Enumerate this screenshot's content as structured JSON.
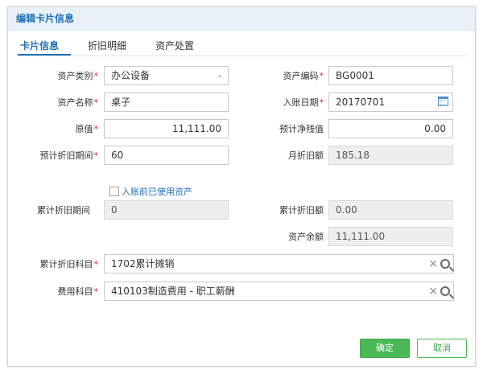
{
  "dialog": {
    "title": "编辑卡片信息"
  },
  "tabs": [
    {
      "label": "卡片信息"
    },
    {
      "label": "折旧明细"
    },
    {
      "label": "资产处置"
    }
  ],
  "form": {
    "asset_category": {
      "label": "资产类别",
      "value": "办公设备"
    },
    "asset_code": {
      "label": "资产编码",
      "value": "BG0001"
    },
    "asset_name": {
      "label": "资产名称",
      "value": "桌子"
    },
    "entry_date": {
      "label": "入账日期",
      "value": "20170701"
    },
    "original_value": {
      "label": "原值",
      "value": "11,111.00"
    },
    "net_residual": {
      "label": "预计净残值",
      "value": "0.00"
    },
    "depreciation_period": {
      "label": "预计折旧期间",
      "value": "60"
    },
    "monthly_depreciation": {
      "label": "月折旧额",
      "value": "185.18"
    },
    "used_before_entry": {
      "label": "入账前已使用资产",
      "checked": false
    },
    "accum_period": {
      "label": "累计折旧期间",
      "value": "0"
    },
    "accum_amount": {
      "label": "累计折旧额",
      "value": "0.00"
    },
    "asset_balance": {
      "label": "资产余额",
      "value": "11,111.00"
    },
    "accum_account": {
      "label": "累计折旧科目",
      "value": "1702累计摊销"
    },
    "expense_account": {
      "label": "费用科目",
      "value": "410103制造费用 - 职工薪酬"
    }
  },
  "buttons": {
    "ok": "确定",
    "cancel": "取消"
  },
  "required_mark": "*",
  "icons": {
    "dropdown": "chevron-down-icon",
    "calendar": "calendar-icon",
    "clear": "close-icon",
    "search": "search-icon"
  },
  "colors": {
    "accent": "#1d6fb8",
    "primary_button": "#4cb957",
    "required": "#e0242b"
  }
}
